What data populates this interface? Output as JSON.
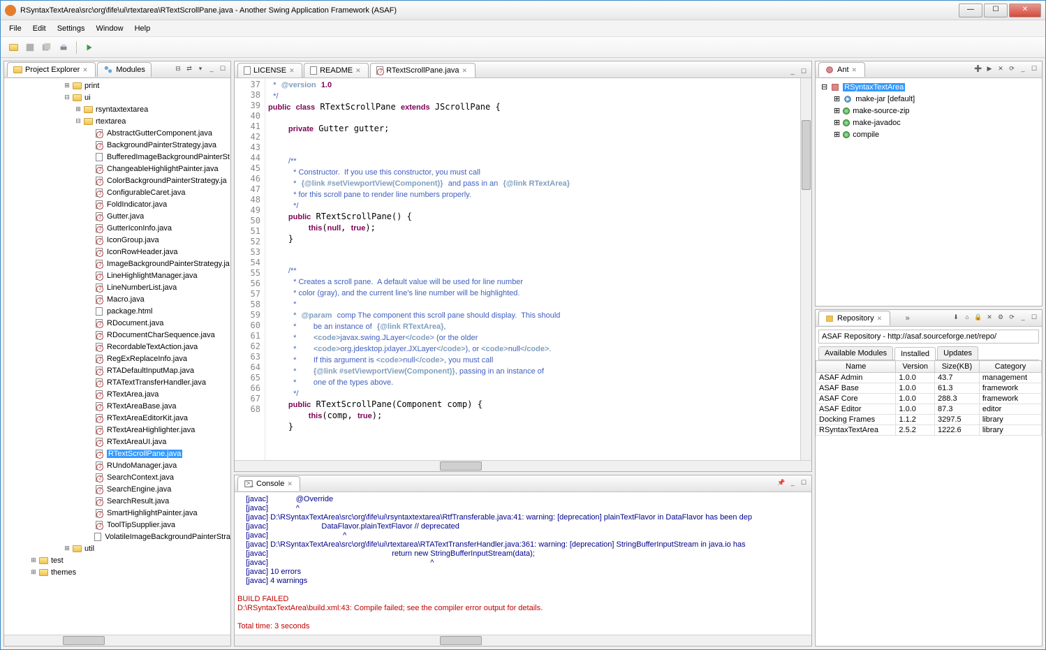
{
  "window": {
    "title": "RSyntaxTextArea\\src\\org\\fife\\ui\\rtextarea\\RTextScrollPane.java - Another Swing Application Framework (ASAF)"
  },
  "menu": [
    "File",
    "Edit",
    "Settings",
    "Window",
    "Help"
  ],
  "explorer": {
    "tab_label": "Project Explorer",
    "modules_tab": "Modules",
    "nodes": {
      "print": "print",
      "ui": "ui",
      "rsyntaxtextarea": "rsyntaxtextarea",
      "rtextarea": "rtextarea",
      "util": "util",
      "test": "test",
      "themes": "themes"
    },
    "files": [
      "AbstractGutterComponent.java",
      "BackgroundPainterStrategy.java",
      "BufferedImageBackgroundPainterSt",
      "ChangeableHighlightPainter.java",
      "ColorBackgroundPainterStrategy.ja",
      "ConfigurableCaret.java",
      "FoldIndicator.java",
      "Gutter.java",
      "GutterIconInfo.java",
      "IconGroup.java",
      "IconRowHeader.java",
      "ImageBackgroundPainterStrategy.ja",
      "LineHighlightManager.java",
      "LineNumberList.java",
      "Macro.java",
      "package.html",
      "RDocument.java",
      "RDocumentCharSequence.java",
      "RecordableTextAction.java",
      "RegExReplaceInfo.java",
      "RTADefaultInputMap.java",
      "RTATextTransferHandler.java",
      "RTextArea.java",
      "RTextAreaBase.java",
      "RTextAreaEditorKit.java",
      "RTextAreaHighlighter.java",
      "RTextAreaUI.java",
      "RTextScrollPane.java",
      "RUndoManager.java",
      "SearchContext.java",
      "SearchEngine.java",
      "SearchResult.java",
      "SmartHighlightPainter.java",
      "ToolTipSupplier.java",
      "VolatileImageBackgroundPainterStra"
    ],
    "selected": "RTextScrollPane.java"
  },
  "editor": {
    "tabs": [
      {
        "label": "LICENSE",
        "icon": "file"
      },
      {
        "label": "README",
        "icon": "file"
      },
      {
        "label": "RTextScrollPane.java",
        "icon": "java",
        "active": true
      }
    ],
    "first_line": 37
  },
  "console": {
    "tab_label": "Console"
  },
  "ant": {
    "tab_label": "Ant",
    "root": "RSyntaxTextArea",
    "targets": [
      "make-jar [default]",
      "make-source-zip",
      "make-javadoc",
      "compile"
    ]
  },
  "repo": {
    "tab_label": "Repository",
    "url": "ASAF Repository - http://asaf.sourceforge.net/repo/",
    "tabs": [
      "Available Modules",
      "Installed",
      "Updates"
    ],
    "active_tab": "Installed",
    "columns": [
      "Name",
      "Version",
      "Size(KB)",
      "Category"
    ],
    "rows": [
      [
        "ASAF Admin",
        "1.0.0",
        "43.7",
        "management"
      ],
      [
        "ASAF Base",
        "1.0.0",
        "61.3",
        "framework"
      ],
      [
        "ASAF Core",
        "1.0.0",
        "288.3",
        "framework"
      ],
      [
        "ASAF Editor",
        "1.0.0",
        "87.3",
        "editor"
      ],
      [
        "Docking Frames",
        "1.1.2",
        "3297.5",
        "library"
      ],
      [
        "RSyntaxTextArea",
        "2.5.2",
        "1222.6",
        "library"
      ]
    ]
  }
}
